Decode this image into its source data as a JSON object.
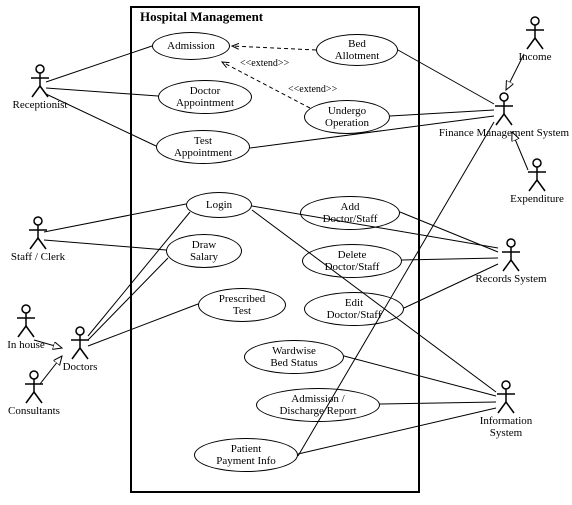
{
  "system": {
    "title": "Hospital Management"
  },
  "usecases": {
    "admission": "Admission",
    "bed_allotment": "Bed\nAllotment",
    "doctor_appt": "Doctor\nAppointment",
    "undergo_op": "Undergo\nOperation",
    "test_appt": "Test\nAppointment",
    "login": "Login",
    "add_ds": "Add\nDoctor/Staff",
    "draw_salary": "Draw\nSalary",
    "delete_ds": "Delete\nDoctor/Staff",
    "prescribed_test": "Prescribed\nTest",
    "edit_ds": "Edit\nDoctor/Staff",
    "wardwise": "Wardwise\nBed Status",
    "adm_dis": "Admission /\nDischarge Report",
    "patient_pay": "Patient\nPayment Info"
  },
  "actors": {
    "receptionist": "Receptionist",
    "staff_clerk": "Staff / Clerk",
    "in_house": "In house",
    "doctors": "Doctors",
    "consultants": "Consultants",
    "income": "Income",
    "finance": "Finance Management System",
    "expenditure": "Expenditure",
    "records": "Records System",
    "info_sys": "Information\nSystem"
  },
  "stereotypes": {
    "extend1": "<<extend>>",
    "extend2": "<<extend>>"
  }
}
